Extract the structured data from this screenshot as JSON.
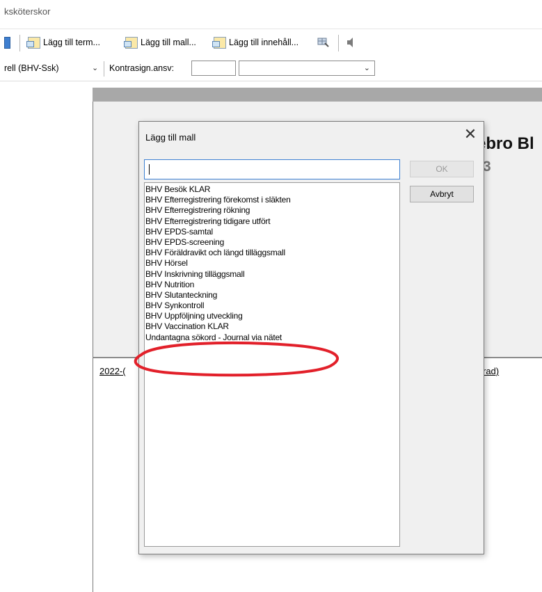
{
  "window": {
    "title": "ksköterskor"
  },
  "toolbar": {
    "buttons": [
      {
        "label": "Lägg till term...",
        "icon": "add-term-icon"
      },
      {
        "label": "Lägg till mall...",
        "icon": "add-template-icon"
      },
      {
        "label": "Lägg till innehåll...",
        "icon": "add-content-icon"
      }
    ],
    "extra_icons": [
      "grid-icon",
      "speaker-icon"
    ]
  },
  "row2": {
    "role_value": "rell (BHV-Ssk)",
    "cosign_label": "Kontrasign.ansv:",
    "cosign_input_value": "",
    "cosign_select_value": ""
  },
  "background_doc": {
    "title_fragment": "ebro Bl",
    "subtitle_fragment": "3",
    "journal_date_fragment": "2022-(",
    "journal_end_fragment": "rad)"
  },
  "dialog": {
    "title": "Lägg till mall",
    "search_value": "",
    "ok_label": "OK",
    "cancel_label": "Avbryt",
    "templates": [
      "BHV Besök KLAR",
      "BHV Efterregistrering förekomst i släkten",
      "BHV Efterregistrering rökning",
      "BHV Efterregistrering tidigare utfört",
      "BHV EPDS-samtal",
      "BHV EPDS-screening",
      "BHV Föräldravikt och längd tilläggsmall",
      "BHV Hörsel",
      "BHV Inskrivning tilläggsmall",
      "BHV Nutrition",
      "BHV Slutanteckning",
      "BHV Synkontroll",
      "BHV Uppföljning utveckling",
      "BHV Vaccination KLAR",
      "Undantagna sökord - Journal via nätet"
    ]
  },
  "colors": {
    "annotation": "#e2202a",
    "accent_focus": "#3c7fd1",
    "doc_header_gray": "#a8a8a8"
  }
}
